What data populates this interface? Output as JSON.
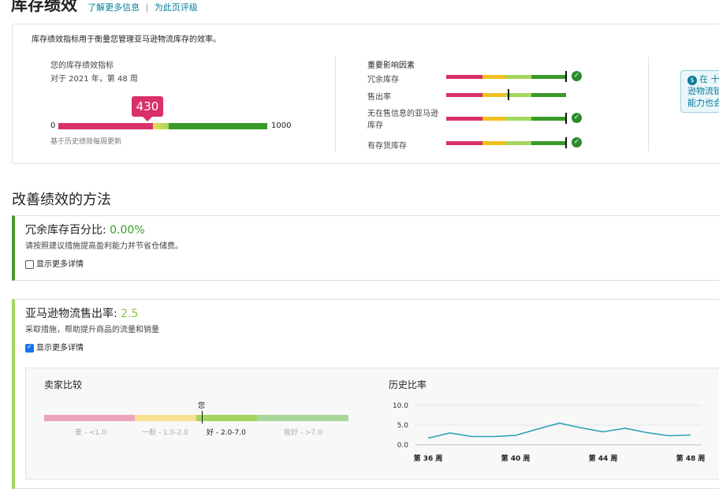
{
  "header": {
    "title": "库存绩效",
    "link_learn_more": "了解更多信息",
    "link_rate_page": "为此页评级"
  },
  "summary_card": {
    "description": "库存绩效指标用于衡量您管理亚马逊物流库存的效率。",
    "ipi_label": "您的库存绩效指标",
    "ipi_period": "对于 2021 年，第 48 周",
    "ipi_value": "430",
    "ipi_score_fraction": 0.43,
    "scale_min": "0",
    "scale_max": "1000",
    "update_note": "基于历史绩效每周更新",
    "factors_title": "重要影响因素",
    "factors": [
      {
        "label": "冗余库存",
        "status": "good"
      },
      {
        "label": "售出率",
        "status": "fair"
      },
      {
        "label": "无在售信息的亚马逊库存",
        "status": "good"
      },
      {
        "label": "有存货库存",
        "status": "good"
      }
    ],
    "info_text_line1": "在 十",
    "info_text_line2": "逊物流锁",
    "info_text_line3": "能力也会"
  },
  "improve": {
    "title": "改善绩效的方法",
    "excess": {
      "label": "冗余库存百分比:",
      "value": "0.00%",
      "desc": "请按照建议措施提高盈利能力并节省仓储费。",
      "toggle": "显示更多详情",
      "checked": false,
      "accent": "#4a9a2a"
    },
    "sellthrough": {
      "label": "亚马逊物流售出率:",
      "value": "2.5",
      "desc": "采取措施，帮助提升商品的流量和销量",
      "toggle": "显示更多详情",
      "checked": true,
      "accent": "#a4d65e"
    }
  },
  "seller_comparison": {
    "title": "卖家比较",
    "you_label": "您",
    "bands": [
      "差 - <1.0",
      "一般 - 1.0-2.0",
      "好 - 2.0-7.0",
      "极好 - >7.0"
    ]
  },
  "history": {
    "title": "历史比率"
  },
  "chart_data": {
    "type": "line",
    "x": [
      "第 36 周",
      "第 37 周",
      "第 38 周",
      "第 39 周",
      "第 40 周",
      "第 41 周",
      "第 42 周",
      "第 43 周",
      "第 44 周",
      "第 45 周",
      "第 46 周",
      "第 47 周",
      "第 48 周"
    ],
    "x_tick_labels": [
      "第 36 周",
      "第 40 周",
      "第 44 周",
      "第 48 周"
    ],
    "series": [
      {
        "values": [
          1.7,
          3.0,
          2.1,
          2.1,
          2.4,
          4.0,
          5.5,
          4.3,
          3.3,
          4.2,
          3.1,
          2.3,
          2.5
        ]
      }
    ],
    "ylim": [
      0,
      10
    ],
    "y_ticks": [
      "10.0",
      "5.0",
      "0.0"
    ],
    "color": "#2aa3b4",
    "grid": true
  },
  "colors": {
    "red": "#d9306b",
    "yellow": "#f0c020",
    "lightgreen": "#a4d65e",
    "green": "#3a9a2a"
  }
}
